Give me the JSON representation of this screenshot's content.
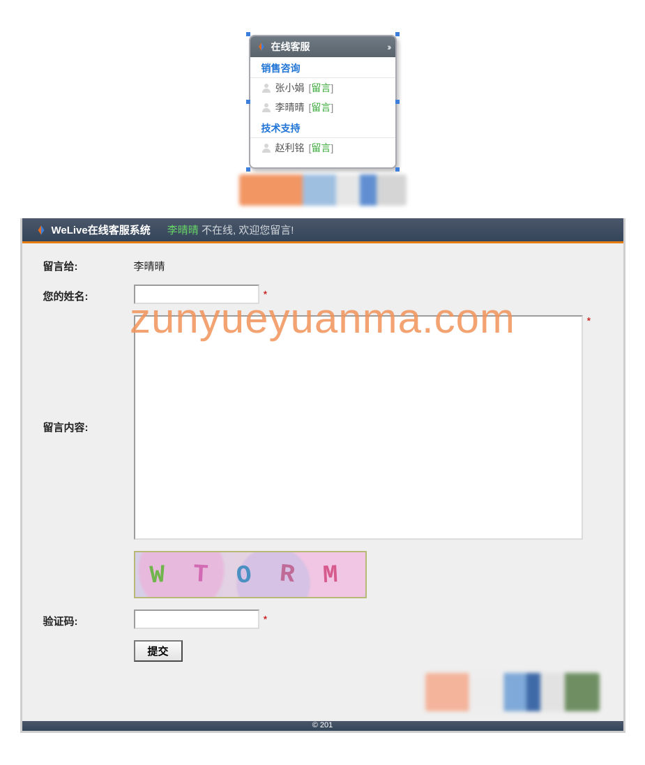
{
  "widget": {
    "title": "在线客服",
    "collapse_icon": "chevrons",
    "categories": [
      {
        "name": "销售咨询",
        "agents": [
          {
            "name": "张小娟",
            "action": "留言"
          },
          {
            "name": "李晴晴",
            "action": "留言"
          }
        ]
      },
      {
        "name": "技术支持",
        "agents": [
          {
            "name": "赵利铭",
            "action": "留言"
          }
        ]
      }
    ]
  },
  "panel": {
    "brand": "WeLive在线客服系统",
    "agent_name": "李晴晴",
    "status_text": "不在线, 欢迎您留言!"
  },
  "form": {
    "label_to": "留言给:",
    "value_to": "李晴晴",
    "label_name": "您的姓名:",
    "name_value": "",
    "label_content": "留言内容:",
    "content_value": "",
    "label_captcha": "验证码:",
    "captcha_value": "",
    "captcha_text": "WTORM",
    "required_mark": "*",
    "submit_label": "提交"
  },
  "watermark": "zunyueyuanma.com",
  "footer_text": "© 201"
}
